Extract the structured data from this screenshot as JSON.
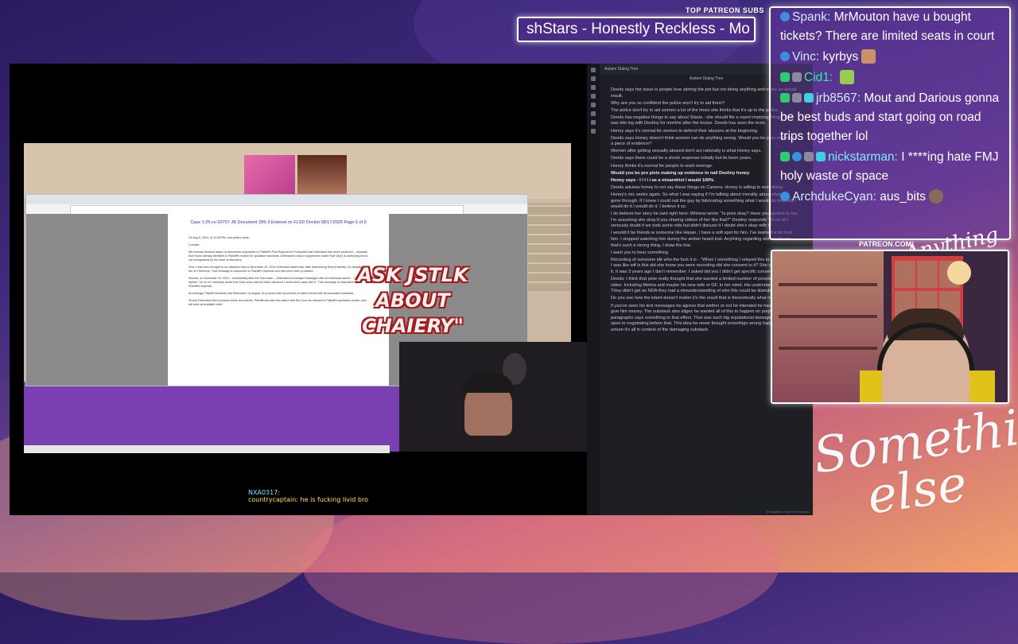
{
  "top_subs": {
    "label": "TOP PATREON SUBS",
    "marquee": "shStars - Honestly Reckless - Mo"
  },
  "main_video": {
    "overlay_text": "ASK JSTLK ABOUT CHAIERY\"",
    "chat_overlay": {
      "line1": "NXA0317:",
      "line2_user": "countrycaptain:",
      "line2_text": "he is fucking livid bro"
    },
    "browser": {
      "tab_label": "Autism Dialog Tree",
      "doc_header": "Case 1:25-cv-20757-JB   Document 285-3   Entered on FLSD Docket 08/17/2026   Page 6 of 9",
      "doc_lines": [
        "On Aug 6, 2024, at 12:28 PM, Ivan peters wrote:",
        "Counsel:",
        "We recently became aware of documents responsive to Plaintiff's First Request for Production that Defendant has never produced -- separate from those already identified in Plaintiff's motion for spoliation sanctions. Defendant's duty to supplement under Rule 26(e) is continuing and is not extinguished by the close of discovery.",
        "First, it has been brought to our attention that on November 20, 2024 Defendant stated that, after determining Rose's identity, he messaged her on Facebook. That message is responsive to Plaintiff's requests and has never been produced.",
        "Second, on November 29, 2024 -- immediately after the Solo leaks -- Defendant exchanged messages with an individual named ... Defendant replied: \"oh no lol I seriously doubt it we took some vids but didn't discuss it I doubt she's okay with it.\" This exchange is responsive to Plaintiff's requests.",
        "Accordingly, Plaintiff demands that Defendant, by August 10 produce both documents in native format with all associated metadata.",
        "Should Defendant fail to produce these documents, Plaintiff will raise this failure with the Court as relevant to Plaintiff's spoliation motion, and will seek all available relief."
      ]
    }
  },
  "notes": {
    "tab_title": "Autism Dialog Tree",
    "title": "Autism Dialog Tree",
    "status": "0 backlinks   1 word   1 character",
    "lines": [
      {
        "text": "Deeds says her issue is people love stirring the pot but not doing anything and make an actual result.",
        "hl": false
      },
      {
        "text": "Why are you so confident the police won't try to aid them?",
        "hl": false
      },
      {
        "text": "The police don't try to aid women a lot of the times she thinks that it's up to the police.",
        "hl": false
      },
      {
        "text": "Deeds has negative things to say about Stasia - she should file a report implying things. She was kiki-ing with Destiny for months after the bruise. Deeds has seen the texts.",
        "hl": false
      },
      {
        "text": "Honey says it's normal for women to defend their abusers at the beginning.",
        "hl": false
      },
      {
        "text": "Deeds says Honey doesn't think women can do anything wrong. Would you be pixie making up a piece of evidence?",
        "hl": false
      },
      {
        "text": "Women after getting sexually abused don't act rationally is what Honey says.",
        "hl": false
      },
      {
        "text": "Deeds says there could be a shock response initially but its been years.",
        "hl": false
      },
      {
        "text": "Honey thinks it's normal for people to want revenge.",
        "hl": false
      },
      {
        "text": "Would you be pro pixie making up evidence to nail Destiny honey",
        "hl": true
      },
      {
        "text": "Honey says - I i I i i as a misandrist I would 100%.",
        "hl": true
      },
      {
        "text": "Deeds advises honey to not say these things on Camera. Honey is willing to something.",
        "hl": false
      },
      {
        "text": "Honey's mic works again. So what I was saying if I'm talking about morality about what i've gone through. If I knew I could nail the guy by fabricating something what I would do honestly I would do it I would do it. I believe it so.",
        "hl": false
      },
      {
        "text": "I do believe her story he said right here: Witness wrote: \"Is pixie okay? Have you spoken to her, I'm assuming she okay'd you sharing videos of her like that?\" Destiny responds \"oh no lol I seriously doubt it we took some vids but didn't discuss it I doubt she's okay with it\"",
        "hl": false
      },
      {
        "text": "I wouldn't be friends w someone like Hasan, I have a soft spot for him. I've learned a lot from him. I stopped watching him during the amber heard trial. Anything regarding women for me that's such a strong thing. I draw the line.",
        "hl": false
      },
      {
        "text": "I want you to hear something",
        "hl": false
      },
      {
        "text": "Recording of someone idk who the fuck it is - \"When I something I relayed this to him in person I was like wtf is this did she know you were recording did she consent to it? She consented to it. It was 3 years ago I don't remember. I asked did you I didn't get specific consent\"",
        "hl": false
      },
      {
        "text": "Deeds: I think that pixie really thought that she wanted a limited number of people to see this video. Including Melina and maybe his new wife or GF. In her mind. His understanding this. THey didn't get an NDA they had a misunderstanding of who this could be distrubuted to.",
        "hl": false
      },
      {
        "text": "Do you see how the intent doesn't matter it's the result that is theoretically what matters.",
        "hl": false
      },
      {
        "text": "If you've seen his text messages he agrees that wether or not he intended he has offered to give him money. The substack also aliges he wanted all of this to happen on purpose the final paragraphs says something to that effect. That was such big reputational damage that he was open to negotiating before that. This idea he never thought somethign wrong happned is just unture it's all in context of the damaging substack.",
        "hl": false
      }
    ]
  },
  "chat": {
    "messages": [
      {
        "user": "Spank:",
        "text": "MrMouton have u bought tickets? There are limited seats in court",
        "user_class": "name"
      },
      {
        "user": "Vinc:",
        "text": "kyrbys",
        "user_class": "name"
      },
      {
        "user": "Cid1:",
        "text": "",
        "user_class": "name green"
      },
      {
        "user": "jrb8567:",
        "text": "Mout and Darious gonna be best buds and start going on road trips together lol",
        "user_class": "name"
      },
      {
        "user": "nickstarman:",
        "text": "I ****ing hate FMJ holy waste of space",
        "user_class": "name teal"
      },
      {
        "user": "ArchdukeCyan:",
        "text": "aus_bits",
        "user_class": "name"
      }
    ]
  },
  "cam": {
    "patreon_label": "PATREON.COM/",
    "script_top": "Anything else?"
  },
  "branding": {
    "line1": "Something",
    "line2": "else"
  }
}
